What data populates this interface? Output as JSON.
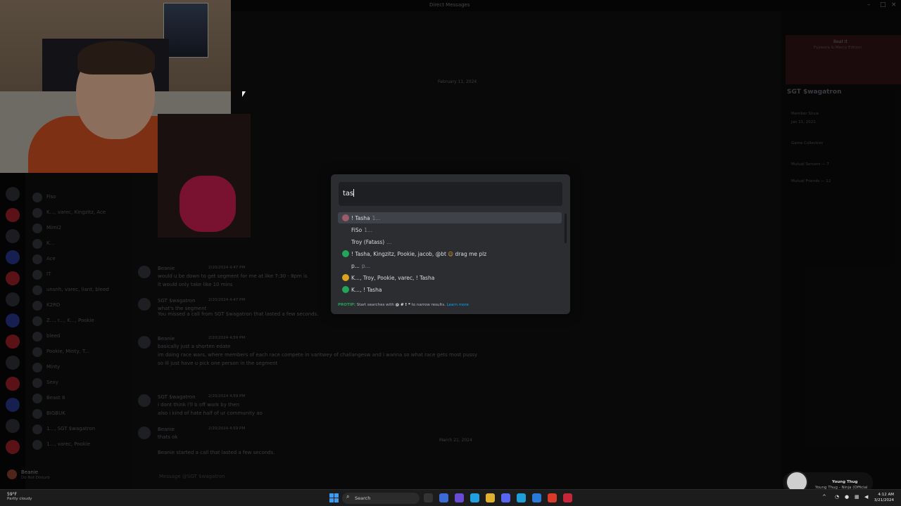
{
  "window": {
    "title": "Direct Messages"
  },
  "chat": {
    "date_dividers": [
      "February 11, 2024",
      "March 21, 2024"
    ],
    "messages": [
      {
        "author": "Beanie",
        "time": "2/20/2024 4:47 PM",
        "lines": [
          "would u be down to get segment for me at like 7:30 - 8pm is",
          "it would only take like 10 mins"
        ]
      },
      {
        "author": "SGT $wagatron",
        "time": "2/20/2024 4:47 PM",
        "lines": [
          "what's the segment"
        ]
      },
      {
        "author": "Beanie",
        "time": "2/20/2024 4:59 PM",
        "lines": [
          "basically just a shorten edate",
          "im doing race wars, where members of each race compete in varitwey of challangesw and i wanna so what race gets most pussy",
          "so ill just have u pick one person in the segment"
        ]
      },
      {
        "author": "SGT $wagatron",
        "time": "2/20/2024 4:59 PM",
        "lines": [
          "i dont think i'll b off work by then",
          "also i kind of hate half of ur community ao"
        ]
      },
      {
        "author": "Beanie",
        "time": "2/20/2024 4:59 PM",
        "lines": [
          "thats ok"
        ]
      }
    ],
    "call_note": "You missed a call from SGT $wagatron that lasted a few seconds.",
    "call_note2": "Beanie started a call that lasted a few seconds.",
    "composer_placeholder": "Message @SGT $wagatron"
  },
  "dm_list": [
    "Fiso",
    "K..., varec, Kingzitz, Ace",
    "Mimi2",
    "K...",
    "Ace",
    "IT",
    "unsnh, varec, liant, bleed",
    "K2RD",
    "Z..., r..., K..., Pookie",
    "bleed",
    "Pookie, Minty, T...",
    "Minty",
    "Sexy",
    "Beast 8",
    "BIGBUK",
    "1..., SGT $wagatron",
    "1..., varec, Pookie"
  ],
  "user": {
    "name": "Beanie",
    "status": "Do Not Disturb"
  },
  "profile": {
    "name": "SGT $wagatron",
    "member_since_label": "Member Since",
    "member_since": "Jan 11, 2021",
    "game_collection": "Game Collection",
    "mutual_servers": "Mutual Servers — 7",
    "mutual_friends": "Mutual Friends — 12",
    "now_playing": "Beat It",
    "now_playing_sub": "Fujiwara & Mercy Edition"
  },
  "switcher": {
    "query": "tas",
    "results": [
      {
        "label": "! Tasha",
        "dim": "1...",
        "icon_color": "#9c5a6a",
        "selected": true
      },
      {
        "label": "FiSo",
        "dim": "1...",
        "icon_color": "",
        "selected": false
      },
      {
        "label": "Troy (Fatass)",
        "dim": "...",
        "icon_color": "",
        "selected": false
      },
      {
        "label": "! Tasha, Kingzitz, Pookie, jacob, @bt",
        "dim": "",
        "emoji": "drag me plz",
        "icon_color": "#23a55a",
        "selected": false
      },
      {
        "label": "p...",
        "dim": "p...",
        "icon_color": "",
        "selected": false
      },
      {
        "label": "K..., Troy, Pookie, varec, ! Tasha",
        "dim": "",
        "icon_color": "#d9a223",
        "selected": false
      },
      {
        "label": "K..., ! Tasha",
        "dim": "",
        "icon_color": "#23a55a",
        "selected": false
      }
    ],
    "protip_label": "PROTIP:",
    "protip_text": "Start searches with",
    "protip_keys": "@ # ! *",
    "protip_tail": "to narrow results.",
    "protip_link": "Learn more"
  },
  "now_playing_widget": {
    "artist": "Young Thug",
    "track": "Young Thug - Ninja (Official Visualizer)"
  },
  "taskbar": {
    "weather_temp": "59°F",
    "weather_desc": "Partly cloudy",
    "search": "Search",
    "time": "4:12 AM",
    "date": "3/21/2024"
  }
}
